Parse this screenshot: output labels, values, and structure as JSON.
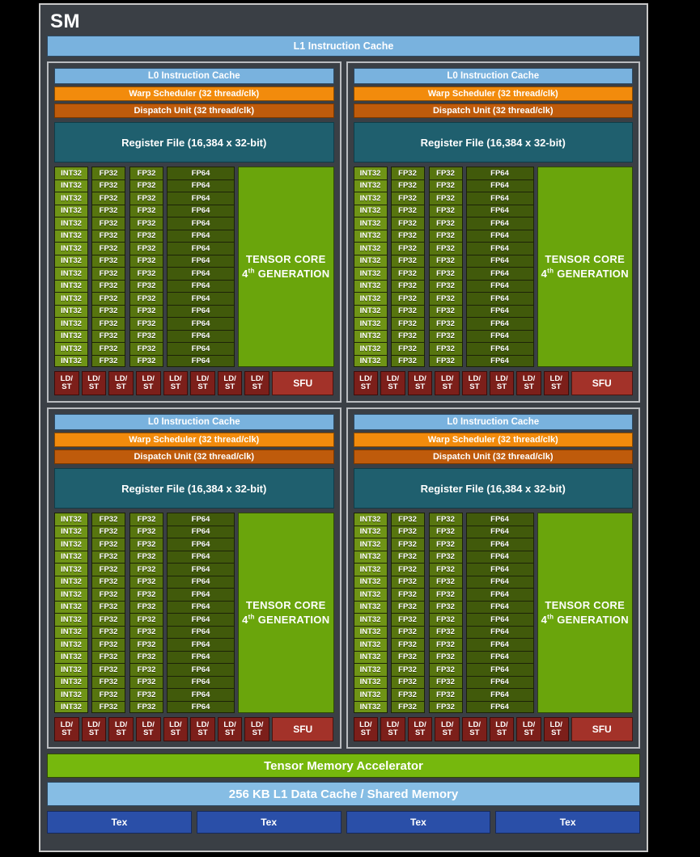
{
  "diagram": {
    "title": "SM",
    "l1_instruction_cache": "L1 Instruction Cache",
    "tensor_memory_accelerator": "Tensor Memory Accelerator",
    "l1_data_cache": "256 KB L1 Data Cache / Shared Memory",
    "tex_label": "Tex",
    "tex_count": 4
  },
  "processing_block": {
    "l0_instruction_cache": "L0 Instruction Cache",
    "warp_scheduler": "Warp Scheduler (32 thread/clk)",
    "dispatch_unit": "Dispatch Unit (32 thread/clk)",
    "register_file": "Register File (16,384 x 32-bit)",
    "int32_label": "INT32",
    "fp32_label": "FP32",
    "fp64_label": "FP64",
    "core_rows": 16,
    "int32_columns": 1,
    "fp32_columns": 2,
    "fp64_columns": 1,
    "tensor_core_line1": "TENSOR CORE",
    "tensor_core_line2_prefix": "4",
    "tensor_core_line2_sup": "th",
    "tensor_core_line2_suffix": " GENERATION",
    "ldst_line1": "LD/",
    "ldst_line2": "ST",
    "ldst_count": 8,
    "sfu_label": "SFU",
    "block_count": 4
  },
  "colors": {
    "page_background": "#000000",
    "panel_background": "#3a3f45",
    "panel_border": "#c8c8c8",
    "instruction_cache": "#79b2de",
    "warp_scheduler": "#f28b0c",
    "dispatch_unit": "#bf5b0b",
    "register_file": "#1f5f6e",
    "int32_core": "#6f9416",
    "fp32_core": "#57750f",
    "fp64_core": "#415a0b",
    "tensor_core": "#6aa50c",
    "ldst_unit": "#7c1f1a",
    "sfu_unit": "#a33229",
    "tensor_memory_accelerator": "#76b80d",
    "l1_data_cache": "#86bde4",
    "tex_unit": "#2a4fa8"
  }
}
